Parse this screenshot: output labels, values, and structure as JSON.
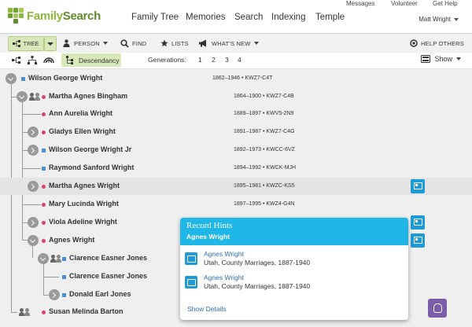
{
  "header": {
    "brand": {
      "part1": "Family",
      "part2": "Search"
    },
    "utility": [
      "Messages",
      "Volunteer",
      "Get Help"
    ],
    "nav": [
      "Family Tree",
      "Memories",
      "Search",
      "Indexing",
      "Temple"
    ],
    "user": "Matt Wright"
  },
  "toolbar": {
    "tree": "TREE",
    "person": "PERSON",
    "find": "FIND",
    "lists": "LISTS",
    "whats_new": "WHAT'S NEW",
    "help_others": "HELP OTHERS"
  },
  "subbar": {
    "view": "Descendancy",
    "generations_label": "Generations:",
    "generations": [
      "1",
      "2",
      "3",
      "4"
    ],
    "show": "Show"
  },
  "tree": {
    "rows": [
      {
        "name": "Wilson George Wright",
        "dates": "1862–1946 • KWZ7-C4T"
      },
      {
        "name": "Martha Agnes Bingham",
        "dates": "1864–1900 • KWZ7-C4B"
      },
      {
        "name": "Ann Aurelia Wright",
        "dates": "1889–1897 • KWV5-2N9"
      },
      {
        "name": "Gladys Ellen Wright",
        "dates": "1891–1987 • KWZ7-C4G"
      },
      {
        "name": "Wilson George Wright Jr",
        "dates": "1892–1973 • KWCC-6VZ"
      },
      {
        "name": "Raymond Sanford Wright",
        "dates": "1894–1992 • KWCK-MJH"
      },
      {
        "name": "Martha Agnes Wright",
        "dates": "1895–1981 • KWZC-KS5"
      },
      {
        "name": "Mary Lucinda Wright",
        "dates": "1897–1995 • KWZ4-G4N"
      },
      {
        "name": "Viola Adeline Wright",
        "dates": ""
      },
      {
        "name": "Agnes Wright",
        "dates": ""
      },
      {
        "name": "Clarence Easner Jones",
        "dates": ""
      },
      {
        "name": "Clarence Easner Jones",
        "dates": ""
      },
      {
        "name": "Donald Earl Jones",
        "dates": ""
      },
      {
        "name": "Susan Melinda Barton",
        "dates": ""
      }
    ]
  },
  "popup": {
    "title": "Record Hints",
    "subtitle": "Agnes Wright",
    "hints": [
      {
        "name": "Agnes Wright",
        "desc": "Utah, County Marriages, 1887-1940"
      },
      {
        "name": "Agnes Wright",
        "desc": "Utah, County Marriages, 1887-1940"
      }
    ],
    "show_details": "Show Details"
  },
  "colors": {
    "brand_green": "#8cb83d",
    "toggle_green": "#d8e8bb",
    "hint_blue": "#1e9ad6",
    "popup_header": "#1fb6e8",
    "link_blue": "#2d6fb3",
    "male": "#4a90d9",
    "female": "#d9436a"
  }
}
